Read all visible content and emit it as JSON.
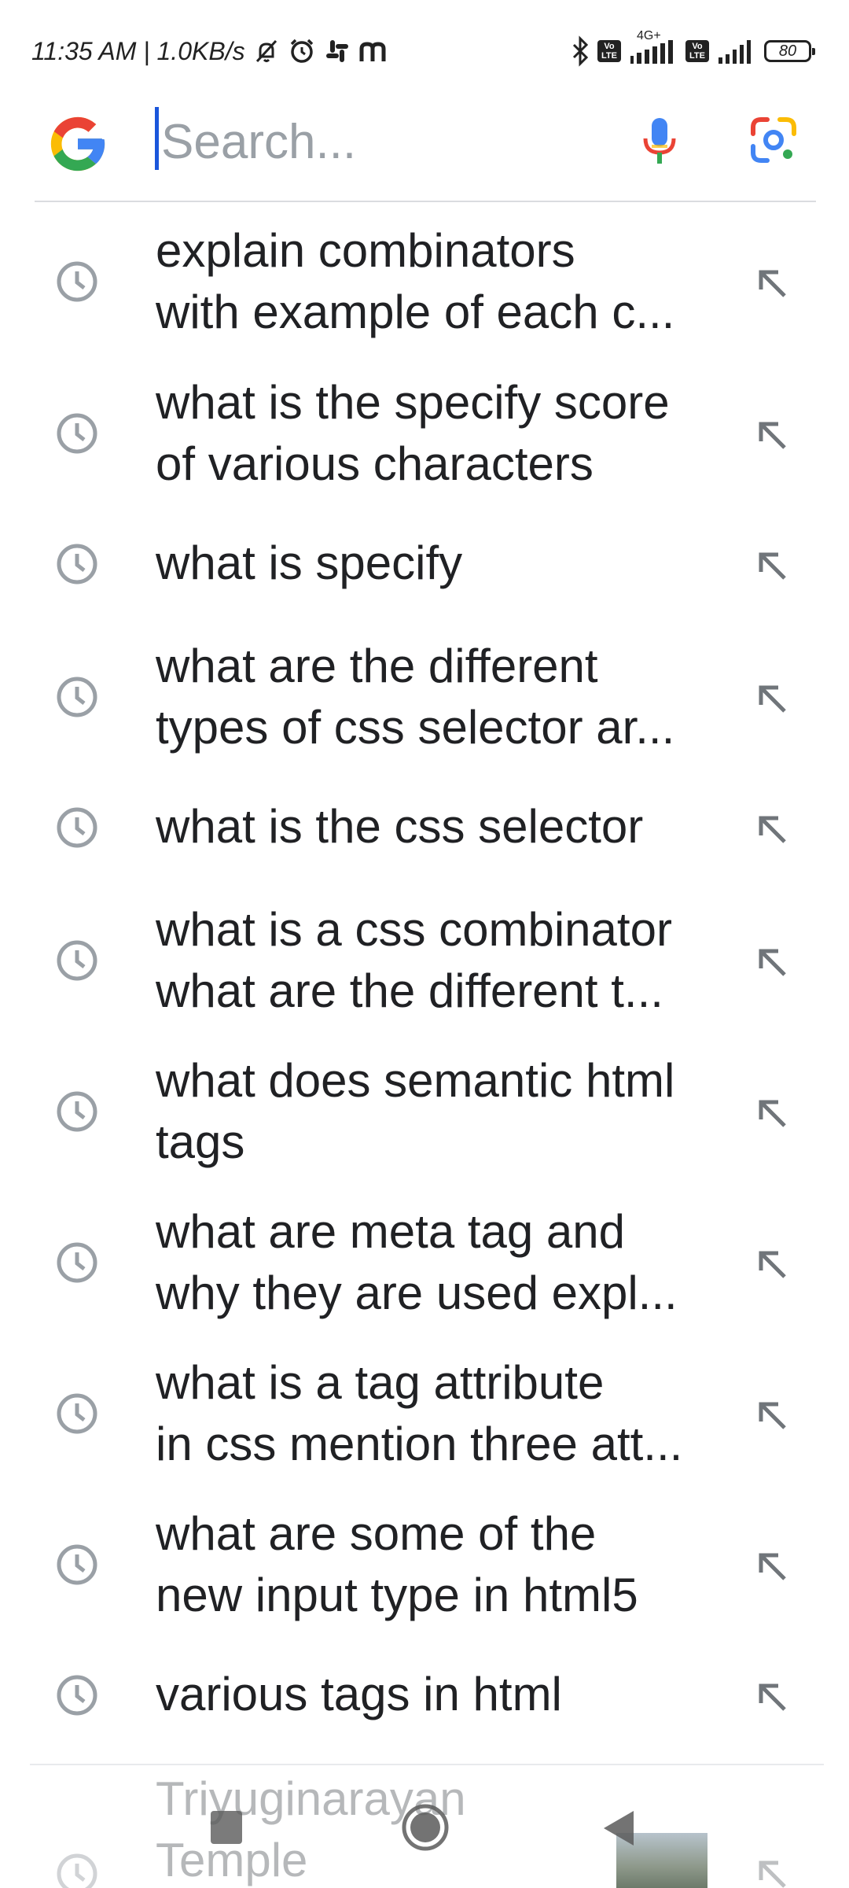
{
  "status_bar": {
    "time_speed": "11:35 AM | 1.0KB/s",
    "network_label": "4G+",
    "volte_label": "Vo LTE",
    "battery": "80",
    "icons": [
      "bell-off-icon",
      "alarm-icon",
      "slack-icon",
      "m-icon",
      "bluetooth-icon",
      "signal-icon"
    ]
  },
  "search": {
    "placeholder": "Search...",
    "value": ""
  },
  "suggestions": [
    {
      "text": "explain combinators\nwith example of each c..."
    },
    {
      "text": "what is the specify score\nof various characters"
    },
    {
      "text": "what is specify"
    },
    {
      "text": "what are the different\ntypes of css selector ar..."
    },
    {
      "text": "what is the css selector"
    },
    {
      "text": "what is a css combinator\nwhat are the different t..."
    },
    {
      "text": "what does semantic html\ntags"
    },
    {
      "text": "what are meta tag and\nwhy they are used expl..."
    },
    {
      "text": "what is a tag attribute\nin css mention three att..."
    },
    {
      "text": "what are some of the\nnew input type in html5"
    },
    {
      "text": "various tags in html"
    }
  ],
  "partial_suggestion": {
    "text": "Triyuginarayan\nTemple"
  },
  "colors": {
    "google_blue": "#4285F4",
    "google_red": "#EA4335",
    "google_yellow": "#FBBC05",
    "google_green": "#34A853",
    "icon_gray": "#9aa0a6",
    "caret": "#1a56db"
  }
}
